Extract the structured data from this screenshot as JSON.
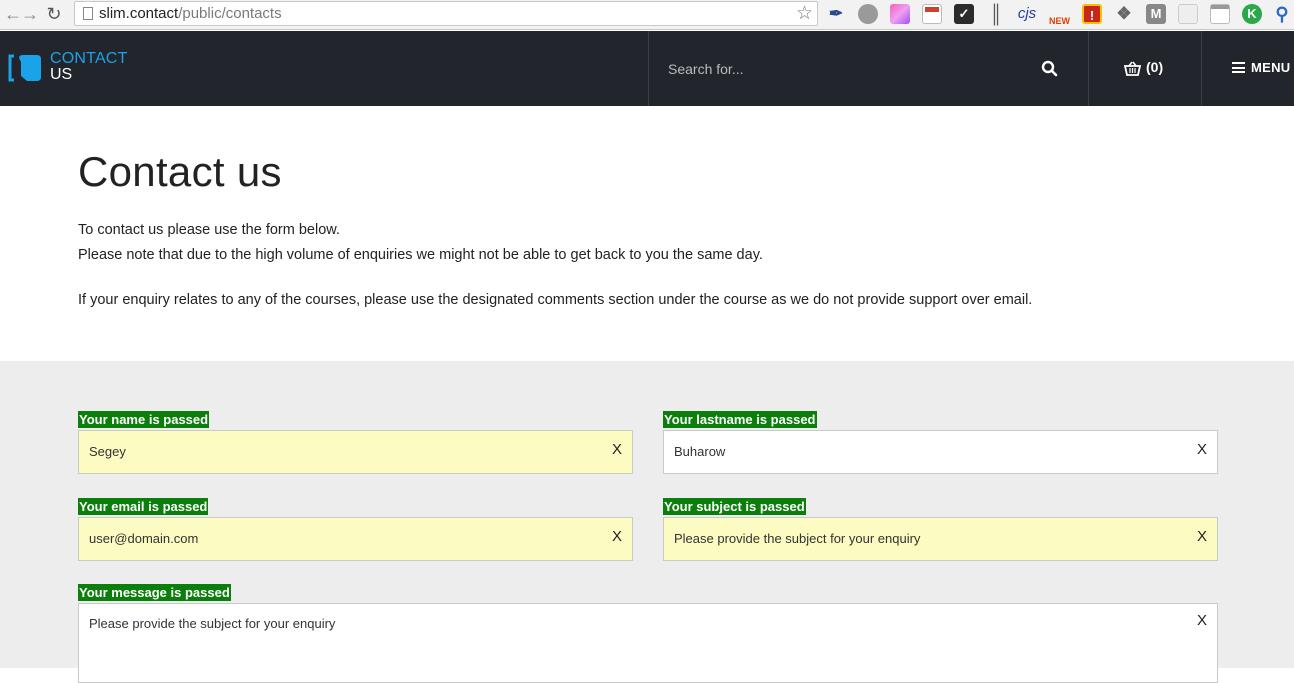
{
  "browser": {
    "url_host": "slim.contact",
    "url_path": "/public/contacts",
    "extensions": [
      "eyedropper-icon",
      "globe-icon",
      "color-icon",
      "calendar-icon",
      "checkmark-icon",
      "columns-icon",
      "cjs-icon",
      "new-icon",
      "alert-icon",
      "puzzle-icon",
      "m-icon",
      "doc-icon",
      "window-icon",
      "k-icon",
      "search-icon"
    ],
    "ext_cjs_label": "cjs",
    "ext_new_label": "NEW",
    "ext_m_label": "M",
    "ext_k_label": "K"
  },
  "header": {
    "logo_line1": "CONTACT",
    "logo_line2": "US",
    "search_placeholder": "Search for...",
    "cart_label": "(0)",
    "menu_label": "MENU",
    "accent_color": "#1aa3e8",
    "bg_color": "#22252b"
  },
  "intro": {
    "title": "Contact us",
    "line1": "To contact us please use the form below.",
    "line2": "Please note that due to the high volume of enquiries we might not be able to get back to you the same day.",
    "line3": "If your enquiry relates to any of the courses, please use the designated comments section under the course as we do not provide support over email."
  },
  "form": {
    "label_bg": "#0b7e0b",
    "highlight_bg": "#fbfbc2",
    "fields": [
      {
        "label": "Your name is passed",
        "value": "Segey",
        "clear": "X"
      },
      {
        "label": "Your lastname is passed",
        "value": "Buharow",
        "clear": "X"
      },
      {
        "label": "Your email is passed",
        "value": "user@domain.com",
        "clear": "X"
      },
      {
        "label": "Your subject is passed",
        "value": "Please provide the subject for your enquiry",
        "clear": "X"
      }
    ],
    "message": {
      "label": "Your message is passed",
      "value": "Please provide the subject for your enquiry",
      "clear": "X"
    }
  }
}
